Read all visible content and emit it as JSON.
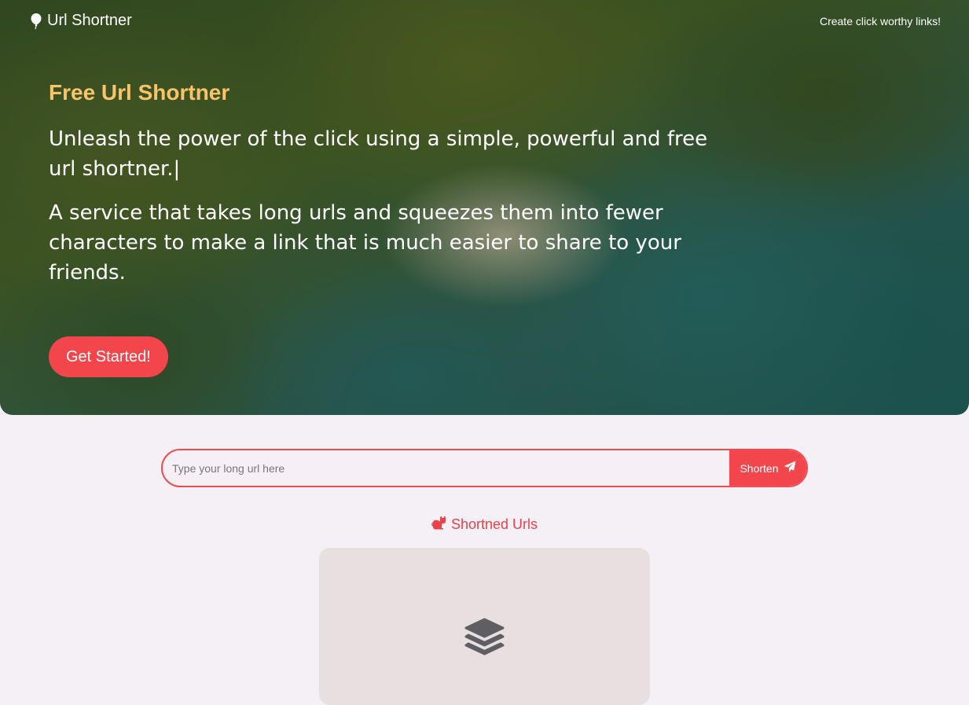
{
  "header": {
    "brand": "Url Shortner",
    "tagline": "Create click worthy links!"
  },
  "hero": {
    "eyebrow": "Free Url Shortner",
    "headline": "Unleash the power of the click using a simple, powerful and free url shortner.|",
    "description": "A service that takes long urls and squeezes them into fewer characters to make a link that is much easier to share to your friends.",
    "cta_label": "Get Started!"
  },
  "shortener": {
    "placeholder": "Type your long url here",
    "button_label": "Shorten"
  },
  "shortened_section": {
    "title": "Shortned Urls",
    "empty_text": ""
  },
  "colors": {
    "accent": "#f2464c",
    "eyebrow": "#f9c36a",
    "page_background": "#f5eff6",
    "card_background": "#e8dfe1"
  },
  "icons": {
    "brand": "balloon-icon",
    "shorten": "paper-plane-icon",
    "section": "cat-icon",
    "empty_state": "layers-icon"
  }
}
